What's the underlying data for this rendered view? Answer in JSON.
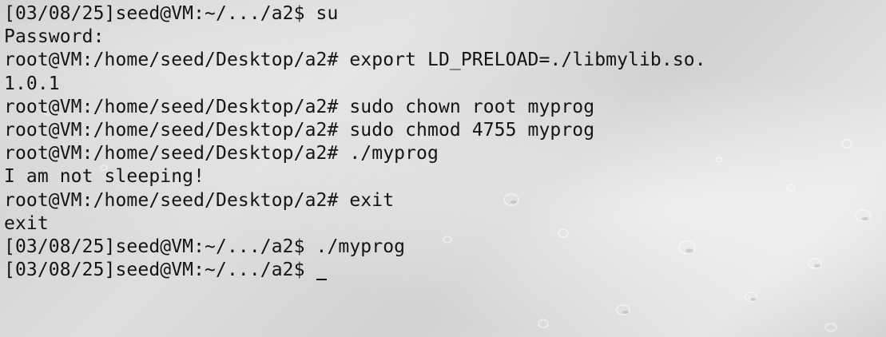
{
  "terminal": {
    "lines": [
      "[03/08/25]seed@VM:~/.../a2$ su",
      "Password:",
      "root@VM:/home/seed/Desktop/a2# export LD_PRELOAD=./libmylib.so.",
      "1.0.1",
      "root@VM:/home/seed/Desktop/a2# sudo chown root myprog",
      "root@VM:/home/seed/Desktop/a2# sudo chmod 4755 myprog",
      "root@VM:/home/seed/Desktop/a2# ./myprog",
      "I am not sleeping!",
      "root@VM:/home/seed/Desktop/a2# exit",
      "exit",
      "[03/08/25]seed@VM:~/.../a2$ ./myprog",
      "[03/08/25]seed@VM:~/.../a2$ "
    ]
  }
}
